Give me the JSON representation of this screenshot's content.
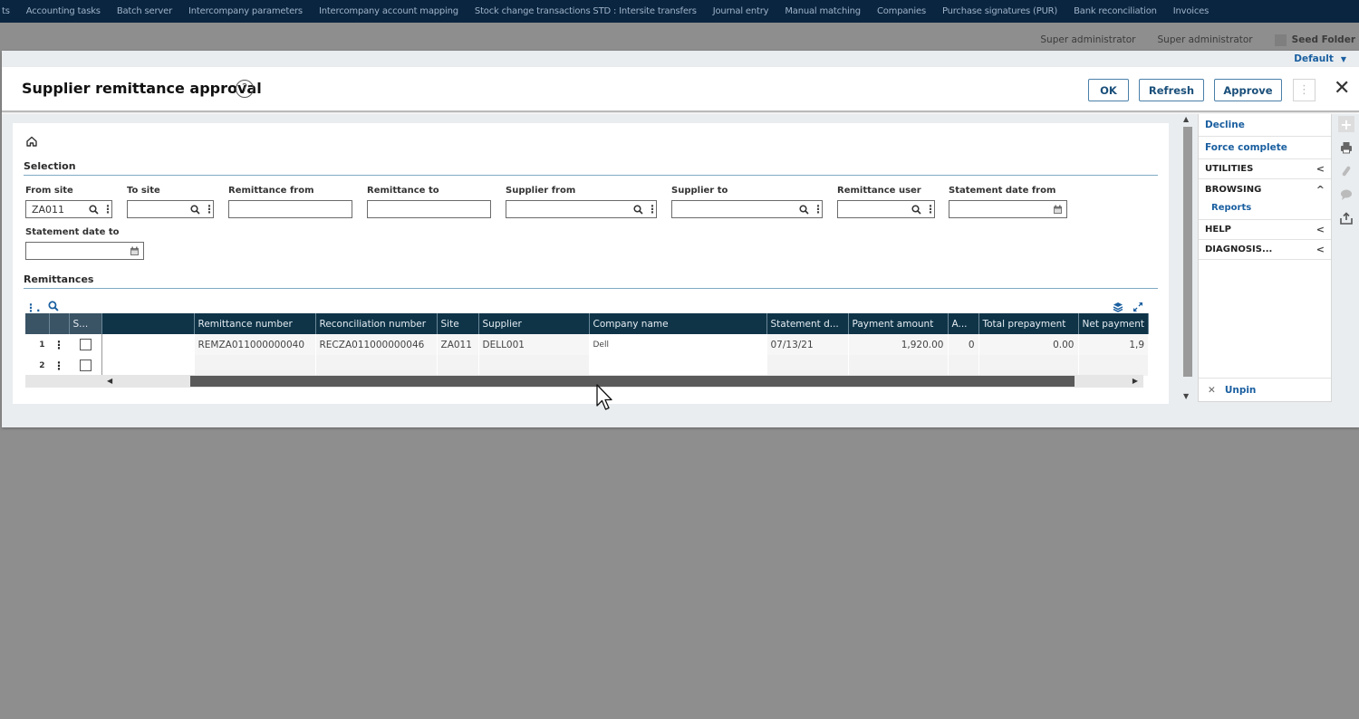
{
  "topnav": {
    "items": [
      "ts",
      "Accounting tasks",
      "Batch server",
      "Intercompany parameters",
      "Intercompany account mapping",
      "Stock change transactions STD : Intersite transfers",
      "Journal entry",
      "Manual matching",
      "Companies",
      "Purchase signatures (PUR)",
      "Bank reconciliation",
      "Invoices"
    ]
  },
  "userbar": {
    "user1": "Super administrator",
    "user2": "Super administrator",
    "folder": "Seed Folder"
  },
  "window": {
    "profile": "Default",
    "title": "Supplier remittance approval",
    "help_icon": "?",
    "buttons": {
      "ok": "OK",
      "refresh": "Refresh",
      "approve": "Approve",
      "more": "⋮",
      "close": "✕"
    }
  },
  "selection": {
    "title": "Selection",
    "fields": {
      "from_site": {
        "label": "From site",
        "value": "ZA011"
      },
      "to_site": {
        "label": "To site",
        "value": ""
      },
      "remittance_from": {
        "label": "Remittance from",
        "value": ""
      },
      "remittance_to": {
        "label": "Remittance to",
        "value": ""
      },
      "supplier_from": {
        "label": "Supplier from",
        "value": ""
      },
      "supplier_to": {
        "label": "Supplier to",
        "value": ""
      },
      "remittance_user": {
        "label": "Remittance user",
        "value": ""
      },
      "statement_date_from": {
        "label": "Statement date from",
        "value": ""
      },
      "statement_date_to": {
        "label": "Statement date to",
        "value": ""
      }
    }
  },
  "remittances": {
    "title": "Remittances",
    "columns": {
      "select": "S...",
      "remittance_number": "Remittance number",
      "reconciliation_number": "Reconciliation number",
      "site": "Site",
      "supplier": "Supplier",
      "company_name": "Company name",
      "statement_date": "Statement d...",
      "payment_amount": "Payment amount",
      "a": "A...",
      "total_prepayment": "Total prepayment",
      "net_payment": "Net payment"
    },
    "rows": [
      {
        "index": "1",
        "remittance_number": "REMZA011000000040",
        "reconciliation_number": "RECZA011000000046",
        "site": "ZA011",
        "supplier": "DELL001",
        "company_name": "Dell",
        "statement_date": "07/13/21",
        "payment_amount": "1,920.00",
        "a": "0",
        "total_prepayment": "0.00",
        "net_payment": "1,9"
      },
      {
        "index": "2",
        "remittance_number": "",
        "reconciliation_number": "",
        "site": "",
        "supplier": "",
        "company_name": "",
        "statement_date": "",
        "payment_amount": "",
        "a": "",
        "total_prepayment": "",
        "net_payment": ""
      }
    ]
  },
  "right_panel": {
    "actions": [
      "Decline",
      "Force complete"
    ],
    "groups": {
      "utilities": "UTILITIES",
      "browsing": "BROWSING",
      "browsing_items": [
        "Reports"
      ],
      "help": "HELP",
      "diagnosis": "DIAGNOSIS..."
    },
    "unpin": "Unpin"
  },
  "colors": {
    "nav_bg": "#0a2540",
    "grid_header": "#0f3448",
    "accent": "#1a5fa0"
  }
}
